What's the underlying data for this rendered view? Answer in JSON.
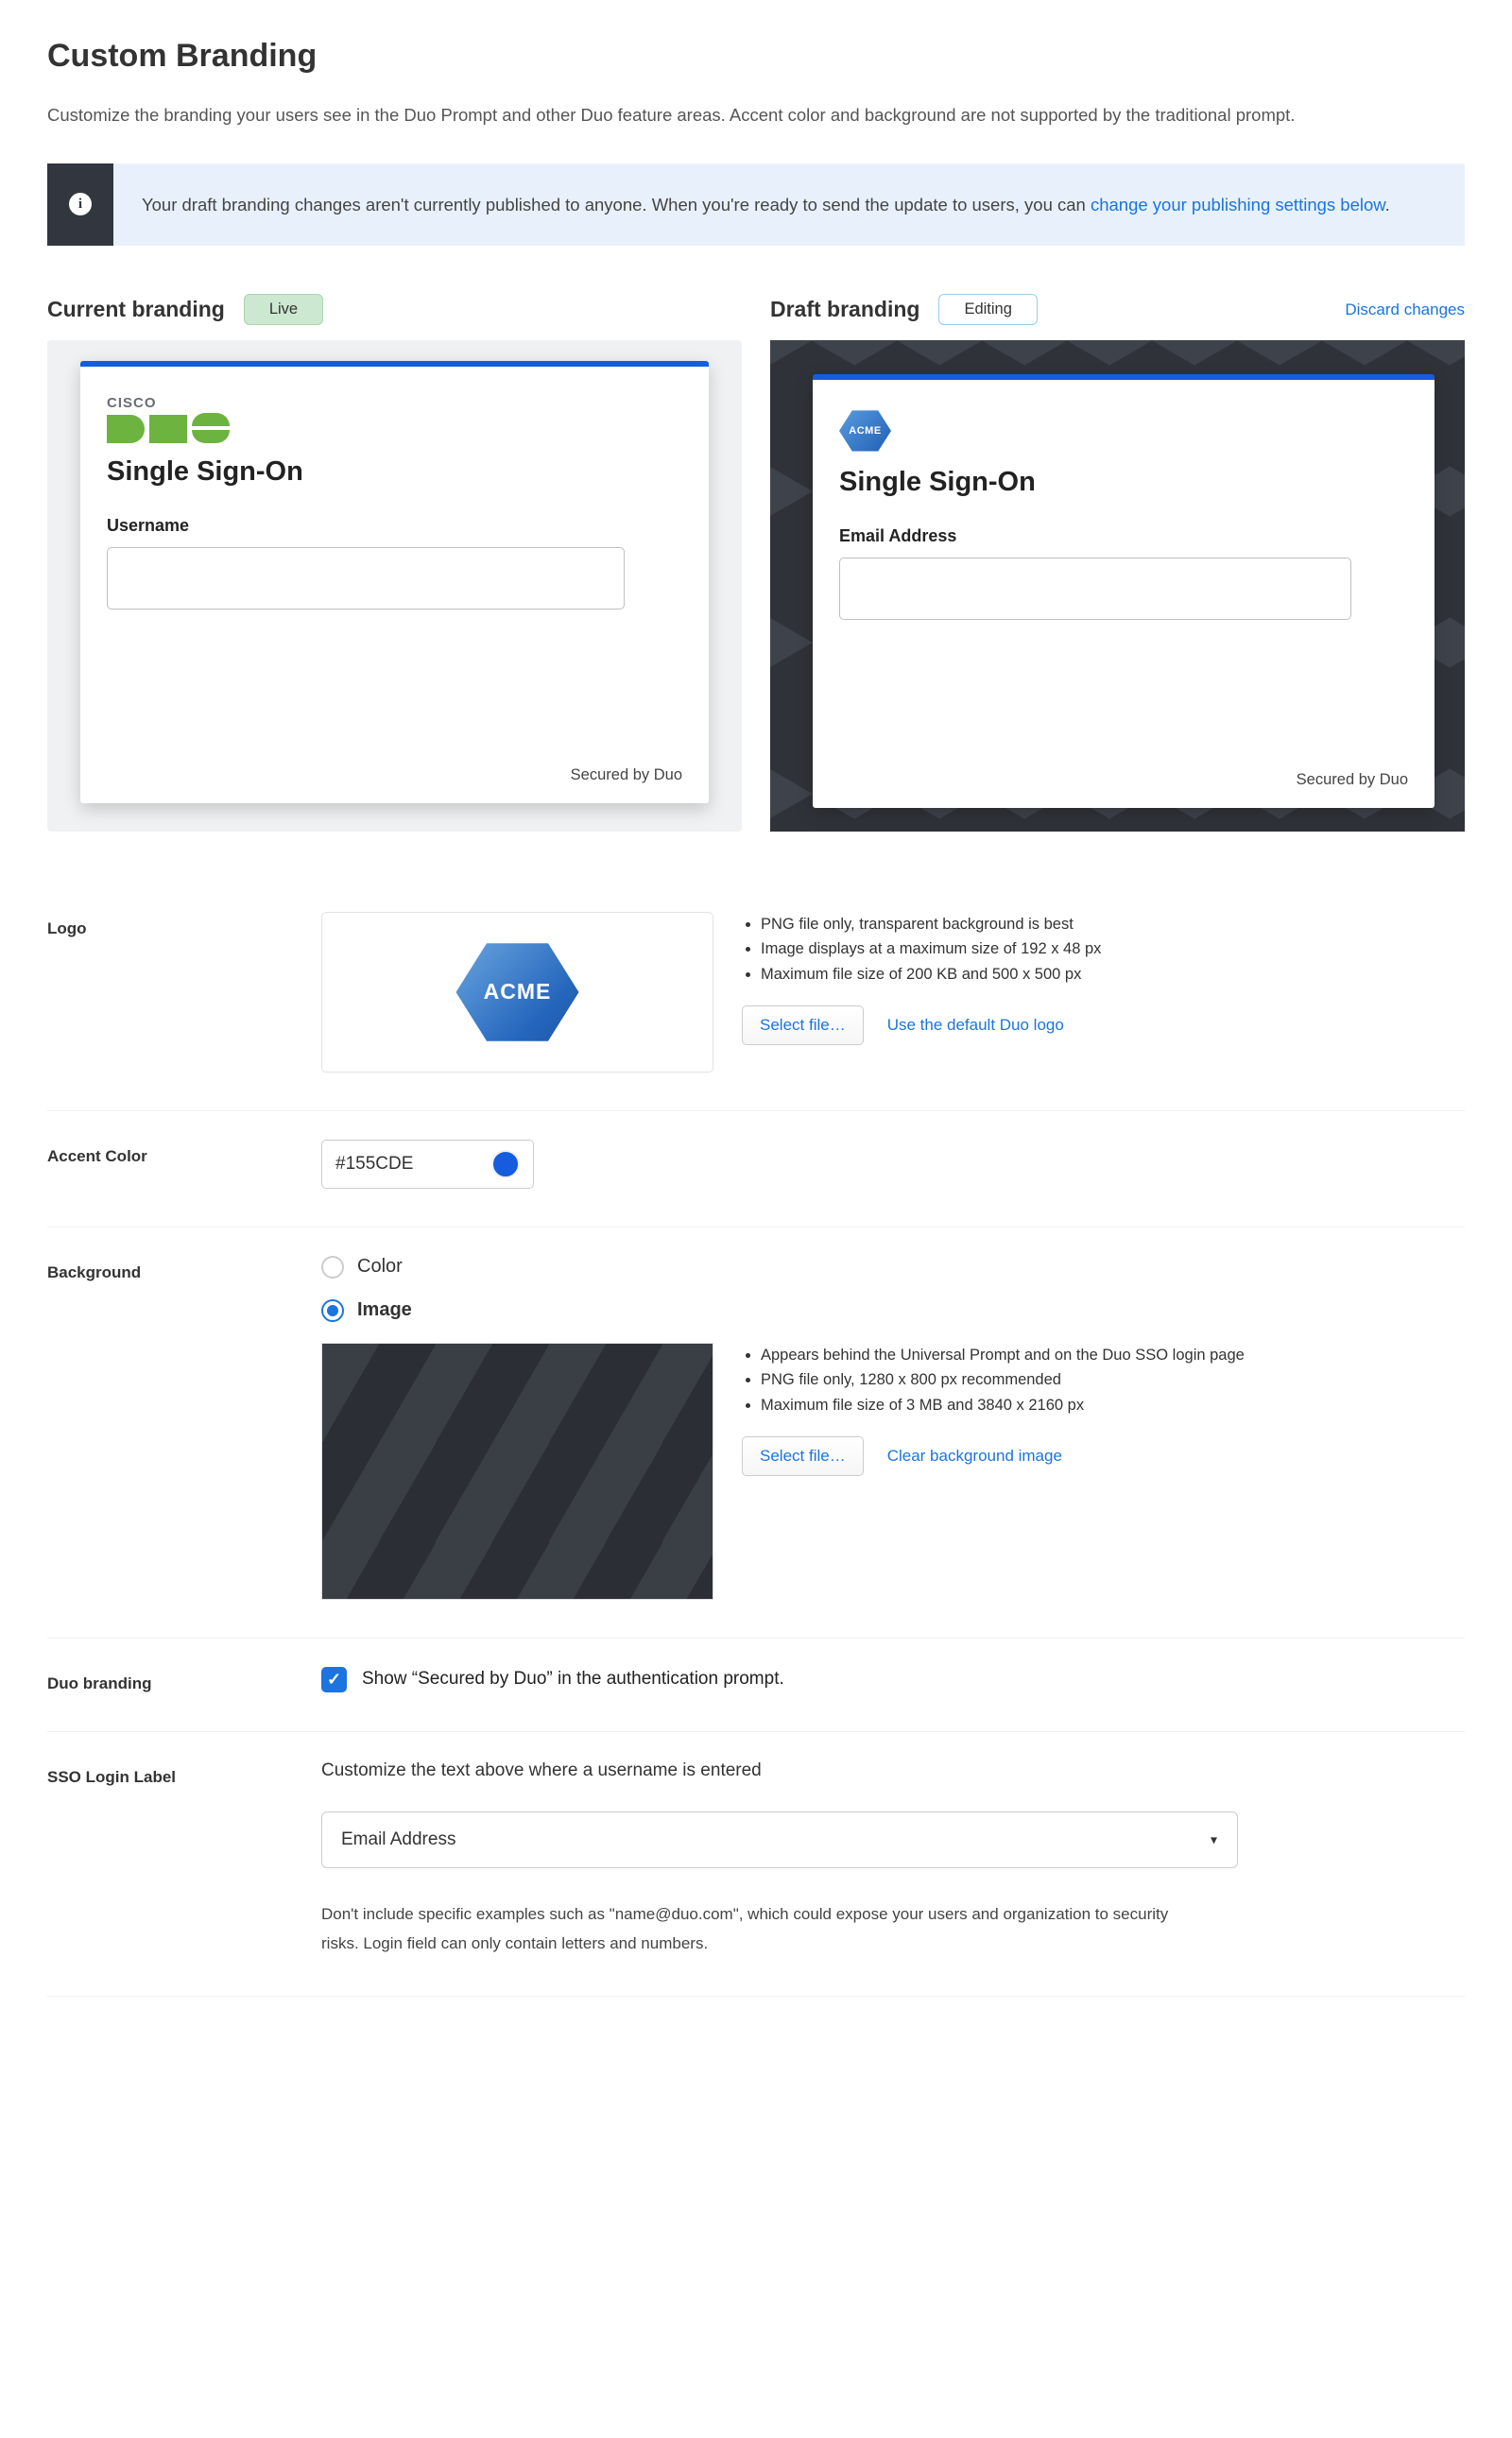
{
  "page": {
    "title": "Custom Branding",
    "intro": "Customize the branding your users see in the Duo Prompt and other Duo feature areas. Accent color and background are not supported by the traditional prompt."
  },
  "banner": {
    "text_before_link": "Your draft branding changes aren't currently published to anyone. When you're ready to send the update to users, you can ",
    "link_text": "change your publishing settings below",
    "period": "."
  },
  "previews": {
    "live": {
      "title": "Current branding",
      "badge": "Live",
      "card": {
        "logo_brand_small": "CISCO",
        "heading": "Single Sign-On",
        "field_label": "Username",
        "footer": "Secured by Duo"
      }
    },
    "draft": {
      "title": "Draft branding",
      "badge": "Editing",
      "discard": "Discard changes",
      "card": {
        "logo_text": "ACME",
        "heading": "Single Sign-On",
        "field_label": "Email Address",
        "footer": "Secured by Duo"
      }
    }
  },
  "settings": {
    "logo": {
      "label": "Logo",
      "preview_text": "ACME",
      "reqs": [
        "PNG file only, transparent background is best",
        "Image displays at a maximum size of 192 x 48 px",
        "Maximum file size of 200 KB and 500 x 500 px"
      ],
      "select_file": "Select file…",
      "default_link": "Use the default Duo logo"
    },
    "accent": {
      "label": "Accent Color",
      "value": "#155CDE",
      "swatch_hex": "#155CDE"
    },
    "background": {
      "label": "Background",
      "option_color": "Color",
      "option_image": "Image",
      "selected": "image",
      "reqs": [
        "Appears behind the Universal Prompt and on the Duo SSO login page",
        "PNG file only, 1280 x 800 px recommended",
        "Maximum file size of 3 MB and 3840 x 2160 px"
      ],
      "select_file": "Select file…",
      "clear_link": "Clear background image"
    },
    "duo_branding": {
      "label": "Duo branding",
      "checked": true,
      "text": "Show “Secured by Duo” in the authentication prompt."
    },
    "sso_login_label": {
      "label": "SSO Login Label",
      "desc": "Customize the text above where a username is entered",
      "value": "Email Address",
      "help": "Don't include specific examples such as \"name@duo.com\", which could expose your users and organization to security risks. Login field can only contain letters and numbers."
    }
  }
}
